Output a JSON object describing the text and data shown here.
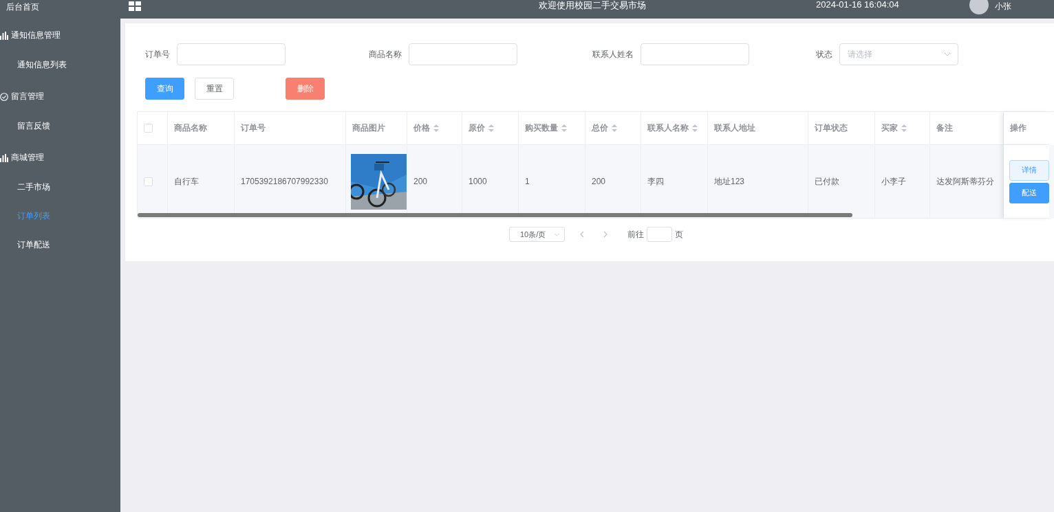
{
  "sidebar": {
    "items": [
      {
        "label": "后台首页",
        "selected": false
      },
      {
        "label": "通知信息管理",
        "kind": "chart",
        "children": [
          {
            "label": "通知信息列表",
            "selected": false
          }
        ]
      },
      {
        "label": "留言管理",
        "kind": "check",
        "children": [
          {
            "label": "留言反馈",
            "selected": false
          }
        ]
      },
      {
        "label": "商城管理",
        "kind": "chart",
        "children": [
          {
            "label": "二手市场",
            "selected": false
          },
          {
            "label": "订单列表",
            "selected": true
          },
          {
            "label": "订单配送",
            "selected": false
          }
        ]
      }
    ]
  },
  "header": {
    "title": "欢迎使用校园二手交易市场",
    "time": "2024-01-16 16:04:04",
    "user": "小张"
  },
  "filters": [
    {
      "label": "订单号",
      "kind": "input"
    },
    {
      "label": "商品名称",
      "kind": "input"
    },
    {
      "label": "联系人姓名",
      "kind": "input"
    },
    {
      "label": "状态",
      "kind": "select",
      "placeholder": "请选择"
    }
  ],
  "buttons": [
    {
      "label": "查询",
      "kind": "primary"
    },
    {
      "label": "重置",
      "kind": "default"
    },
    {
      "label": "删除",
      "kind": "danger"
    }
  ],
  "table": {
    "all_checked": false,
    "columns": [
      {
        "label": "商品名称",
        "sortable": false
      },
      {
        "label": "订单号",
        "sortable": false
      },
      {
        "label": "商品图片",
        "sortable": false
      },
      {
        "label": "价格",
        "sortable": true
      },
      {
        "label": "原价",
        "sortable": true
      },
      {
        "label": "购买数量",
        "sortable": true
      },
      {
        "label": "总价",
        "sortable": true
      },
      {
        "label": "联系人名称",
        "sortable": true
      },
      {
        "label": "联系人地址",
        "sortable": false
      },
      {
        "label": "订单状态",
        "sortable": false
      },
      {
        "label": "买家",
        "sortable": true
      },
      {
        "label": "备注",
        "sortable": false
      },
      {
        "label": "操作",
        "sortable": false
      }
    ],
    "rows": [
      {
        "checked": false,
        "cells": [
          {
            "kind": "text",
            "text": "自行车"
          },
          {
            "kind": "text",
            "text": "1705392186707992330"
          },
          {
            "kind": "picture"
          },
          {
            "kind": "text",
            "text": "200"
          },
          {
            "kind": "text",
            "text": "1000"
          },
          {
            "kind": "text",
            "text": "1"
          },
          {
            "kind": "text",
            "text": "200"
          },
          {
            "kind": "text",
            "text": "李四"
          },
          {
            "kind": "text",
            "text": "地址123"
          },
          {
            "kind": "text",
            "text": "已付款"
          },
          {
            "kind": "text",
            "text": "小李子"
          },
          {
            "kind": "text",
            "text": "达发阿斯蒂芬分"
          }
        ],
        "actions": [
          {
            "label": "详情",
            "kind": "plain"
          },
          {
            "label": "配送",
            "kind": "primary"
          }
        ]
      }
    ]
  },
  "pagination": {
    "page_size": "10条/页",
    "goto": "前往",
    "unit": "页"
  }
}
